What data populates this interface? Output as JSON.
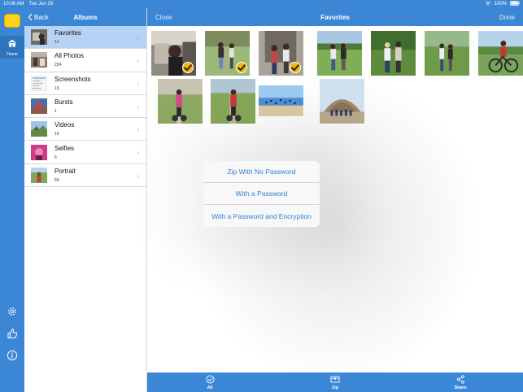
{
  "status_bar": {
    "time": "10:08 AM",
    "date": "Tue Jan 29",
    "battery": "100%"
  },
  "rail": {
    "home_label": "Home"
  },
  "albums_pane": {
    "back_label": "Back",
    "title": "Albums",
    "albums": [
      {
        "name": "Favorites",
        "count": "12",
        "selected": true
      },
      {
        "name": "All Photos",
        "count": "224"
      },
      {
        "name": "Screenshots",
        "count": "19"
      },
      {
        "name": "Bursts",
        "count": "1"
      },
      {
        "name": "Videos",
        "count": "10"
      },
      {
        "name": "Selfies",
        "count": "6"
      },
      {
        "name": "Portrait",
        "count": "69"
      }
    ]
  },
  "main_header": {
    "close_label": "Close",
    "title": "Favorites",
    "done_label": "Done"
  },
  "photos": [
    {
      "selected": true
    },
    {
      "selected": true
    },
    {
      "selected": true
    },
    {
      "selected": false
    },
    {
      "selected": false
    },
    {
      "selected": false
    },
    {
      "selected": false
    },
    {
      "selected": false
    },
    {
      "selected": false
    },
    {
      "selected": false
    },
    {
      "selected": false
    }
  ],
  "action_sheet": {
    "options": [
      "Zip With No Password",
      "With a Password",
      "With a Password and Encryption"
    ],
    "accent": "#2f7fd6"
  },
  "toolbar": {
    "all_label": "All",
    "zip_label": "Zip",
    "share_label": "Share"
  },
  "colors": {
    "brand": "#3c87d5",
    "selected_row": "#b6d2f4",
    "check": "#f7b500"
  }
}
